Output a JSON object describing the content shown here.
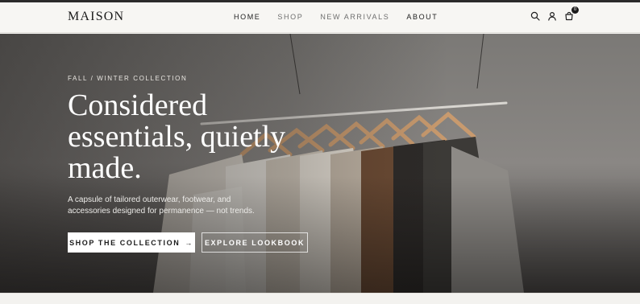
{
  "brand": {
    "logo": "MAISON"
  },
  "nav": {
    "items": [
      {
        "label": "HOME",
        "state": "active"
      },
      {
        "label": "SHOP",
        "state": "muted"
      },
      {
        "label": "NEW ARRIVALS",
        "state": "muted"
      },
      {
        "label": "ABOUT",
        "state": "strong"
      }
    ],
    "icons": [
      "search-icon",
      "account-icon",
      "cart-icon"
    ],
    "cart_count": "0"
  },
  "hero": {
    "eyebrow": "FALL / WINTER COLLECTION",
    "headline": "Considered essentials, quietly made.",
    "subcopy": "A capsule of tailored outerwear, footwear, and accessories designed for permanence — not trends.",
    "primary_cta": "SHOP THE COLLECTION",
    "primary_cta_icon": "→",
    "secondary_cta": "EXPLORE LOOKBOOK"
  },
  "colors": {
    "topline": "#2b2b2b",
    "nav_bg": "#f7f6f3",
    "text_dark": "#1b1b1b",
    "text_muted": "#6f6f6f",
    "hero_text": "#ffffff"
  }
}
